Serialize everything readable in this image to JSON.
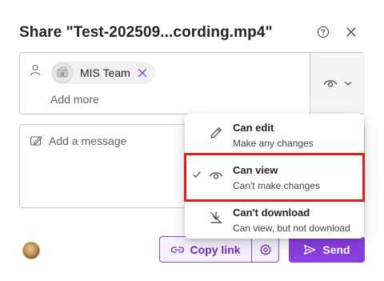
{
  "dialog": {
    "title": "Share \"Test-202509...cording.mp4\"",
    "help_icon": "help-circle-icon",
    "close_icon": "close-icon"
  },
  "recipients": {
    "chips": [
      {
        "label": "MIS Team",
        "avatar_icon": "group-avatar-icon",
        "remove_icon": "dismiss-icon"
      }
    ],
    "add_more": "Add more",
    "permission_icon": "eye-icon"
  },
  "message": {
    "placeholder": "Add a message"
  },
  "permissions_menu": {
    "items": [
      {
        "title": "Can edit",
        "description": "Make any changes",
        "icon": "pencil-icon",
        "selected": false
      },
      {
        "title": "Can view",
        "description": "Can't make changes",
        "icon": "eye-icon",
        "selected": true
      },
      {
        "title": "Can't download",
        "description": "Can view, but not download",
        "icon": "no-download-icon",
        "selected": false
      }
    ]
  },
  "footer": {
    "copy_link_label": "Copy link",
    "send_label": "Send"
  },
  "colors": {
    "accent": "#8a3ee0",
    "accent_text": "#6b2fb8",
    "highlight_border": "#d9201b"
  }
}
